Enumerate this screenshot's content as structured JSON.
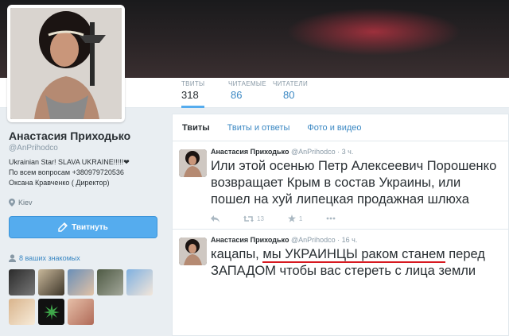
{
  "profile": {
    "name": "Анастасия Приходько",
    "handle": "@AnPrihodco",
    "bio_lines": [
      "Ukrainian Star! SLAVA UKRAINE!!!!!❤",
      "По всем вопросам +380979720536",
      "Оксана Кравченко ( Директор)"
    ],
    "location": "Kiev",
    "tweet_button_label": "Твитнуть",
    "followers_you_know": "8 ваших знакомых"
  },
  "stats": [
    {
      "label": "ТВИТЫ",
      "value": "318"
    },
    {
      "label": "ЧИТАЕМЫЕ",
      "value": "86"
    },
    {
      "label": "ЧИТАТЕЛИ",
      "value": "80"
    }
  ],
  "tabs": [
    {
      "label": "Твиты"
    },
    {
      "label": "Твиты и ответы"
    },
    {
      "label": "Фото и видео"
    }
  ],
  "tweets": [
    {
      "name": "Анастасия Приходько",
      "handle": "@AnPrihodco",
      "time": "· 3 ч.",
      "text": "Или этой осенью Петр Алексеевич Порошенко возвращает Крым в состав Украины, или пошел на хуй липецкая продажная шлюха",
      "retweets": "13",
      "favorites": "1"
    },
    {
      "name": "Анастасия Приходько",
      "handle": "@AnPrihodco",
      "time": "· 16 ч.",
      "text_before": "кацапы, ",
      "text_underlined": "мы УКРАИНЦЫ раком станем",
      "text_after": " перед ЗАПАДОМ чтобы вас стереть с лица земли"
    }
  ],
  "colors": {
    "accent": "#55acee",
    "link": "#3b88c3",
    "underline_red": "#d71920"
  },
  "icons": {
    "location": "map-pin-icon",
    "compose": "compose-icon",
    "followers": "person-icon",
    "reply": "reply-icon",
    "retweet": "retweet-icon",
    "favorite": "star-icon",
    "more": "more-icon"
  }
}
